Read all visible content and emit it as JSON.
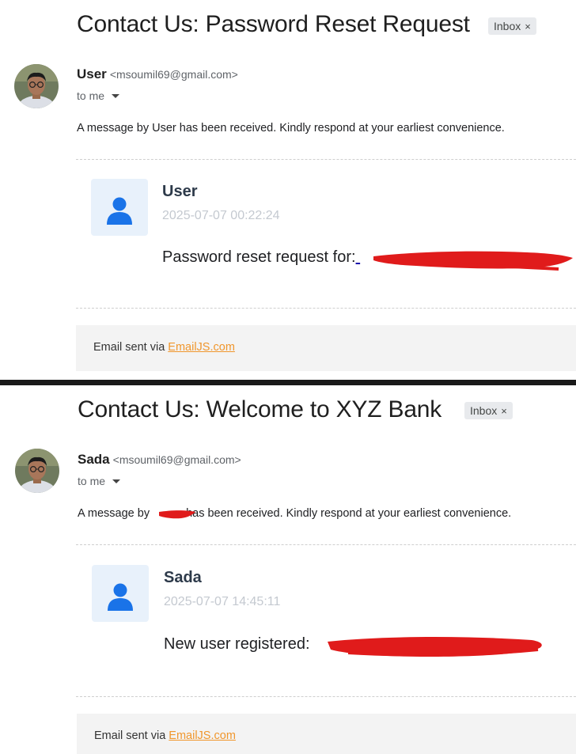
{
  "emails": [
    {
      "subject": "Contact Us: Password Reset Request",
      "label": "Inbox",
      "label_close": "×",
      "sender_name": "User",
      "sender_email": "<msoumil69@gmail.com>",
      "to_me": "to me",
      "intro_text": "A message by User has been received. Kindly respond at your earliest convenience.",
      "card_name": "User",
      "card_time": "2025-07-07 00:22:24",
      "card_message": "Password reset request for:",
      "footer_prefix": "Email sent via ",
      "footer_link": "EmailJS.com"
    },
    {
      "subject": "Contact Us: Welcome to XYZ Bank",
      "label": "Inbox",
      "label_close": "×",
      "sender_name": "Sada",
      "sender_email": "<msoumil69@gmail.com>",
      "to_me": "to me",
      "intro_before": "A message by",
      "intro_after": "has been received. Kindly respond at your earliest convenience.",
      "card_name": "Sada",
      "card_time": "2025-07-07 14:45:11",
      "card_message": "New user registered:",
      "footer_prefix": "Email sent via ",
      "footer_link": "EmailJS.com"
    }
  ],
  "colors": {
    "redaction": "#e01b1b",
    "link": "#1a0dab",
    "footer_link": "#f0962c",
    "card_icon_bg": "#e8f1fb",
    "card_icon": "#1a73e8"
  },
  "icons": {
    "avatar": "sender-photo",
    "card": "person-icon",
    "dropdown": "caret-down-icon",
    "label_close": "close-icon"
  }
}
